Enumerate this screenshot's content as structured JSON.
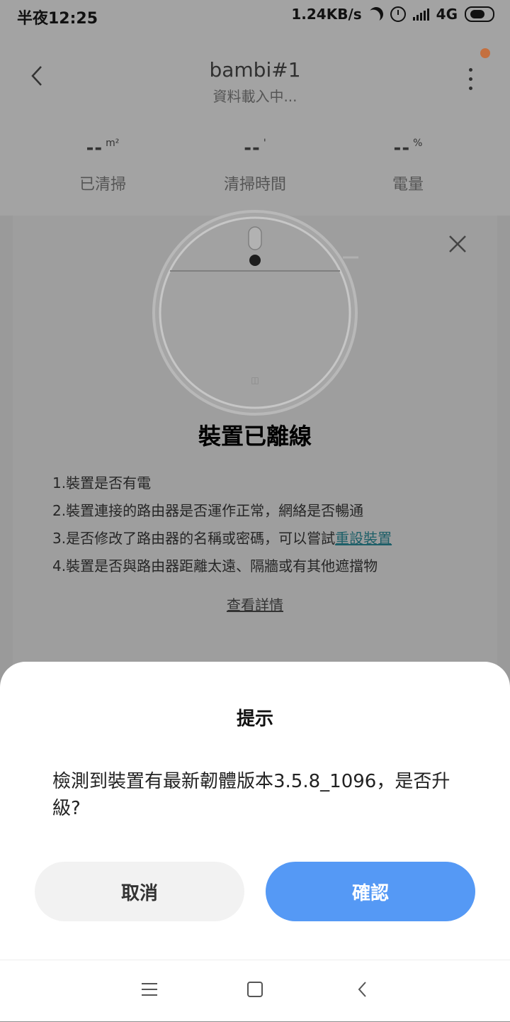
{
  "status_bar": {
    "time": "半夜12:25",
    "speed": "1.24KB/s",
    "network": "4G"
  },
  "header": {
    "device_name": "bambi#1",
    "subtitle": "資料載入中..."
  },
  "stats": [
    {
      "value": "--",
      "unit": "m²",
      "label": "已清掃"
    },
    {
      "value": "--",
      "unit": "'",
      "label": "清掃時間"
    },
    {
      "value": "--",
      "unit": "%",
      "label": "電量"
    }
  ],
  "offline_card": {
    "title": "裝置已離線",
    "tips": [
      "1.裝置是否有電",
      "2.裝置連接的路由器是否運作正常，網絡是否暢通",
      "3.是否修改了路由器的名稱或密碼，可以嘗試",
      "4.裝置是否與路由器距離太遠、隔牆或有其他遮擋物"
    ],
    "reset_link": "重設裝置",
    "details_link": "查看詳情"
  },
  "dialog": {
    "title": "提示",
    "message": "檢測到裝置有最新韌體版本3.5.8_1096，是否升級?",
    "cancel_label": "取消",
    "confirm_label": "確認"
  },
  "colors": {
    "confirm_button": "#5599f5",
    "cancel_button": "#f2f2f2",
    "notification_dot": "#c4703f"
  }
}
